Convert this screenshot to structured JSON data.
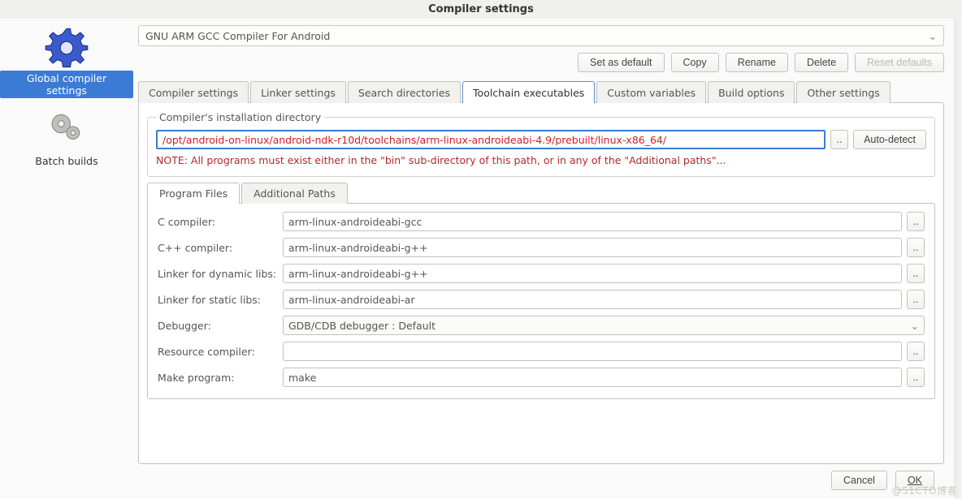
{
  "window_title": "Compiler settings",
  "sidebar": {
    "items": [
      {
        "label": "Global compiler settings",
        "selected": true
      },
      {
        "label": "Batch builds",
        "selected": false
      }
    ]
  },
  "compiler_selector": {
    "value": "GNU ARM GCC Compiler For Android"
  },
  "action_buttons": {
    "set_default": "Set as default",
    "copy": "Copy",
    "rename": "Rename",
    "delete": "Delete",
    "reset_defaults": "Reset defaults"
  },
  "tabs": [
    "Compiler settings",
    "Linker settings",
    "Search directories",
    "Toolchain executables",
    "Custom variables",
    "Build options",
    "Other settings"
  ],
  "active_tab_index": 3,
  "install_dir": {
    "legend": "Compiler's installation directory",
    "path": "/opt/android-on-linux/android-ndk-r10d/toolchains/arm-linux-androideabi-4.9/prebuilt/linux-x86_64/",
    "browse_label": "..",
    "autodetect_label": "Auto-detect",
    "note": "NOTE: All programs must exist either in the \"bin\" sub-directory of this path, or in any of the \"Additional paths\"..."
  },
  "subtabs": [
    "Program Files",
    "Additional Paths"
  ],
  "active_subtab_index": 0,
  "programs": {
    "rows": [
      {
        "label": "C compiler:",
        "value": "arm-linux-androideabi-gcc",
        "browse": true
      },
      {
        "label": "C++ compiler:",
        "value": "arm-linux-androideabi-g++",
        "browse": true
      },
      {
        "label": "Linker for dynamic libs:",
        "value": "arm-linux-androideabi-g++",
        "browse": true
      },
      {
        "label": "Linker for static libs:",
        "value": "arm-linux-androideabi-ar",
        "browse": true
      },
      {
        "label": "Debugger:",
        "value": "GDB/CDB debugger : Default",
        "combo": true
      },
      {
        "label": "Resource compiler:",
        "value": "",
        "browse": true
      },
      {
        "label": "Make program:",
        "value": "make",
        "browse": true
      }
    ],
    "browse_label": ".."
  },
  "footer": {
    "cancel": "Cancel",
    "ok": "OK"
  },
  "watermark": "@51CTO博客"
}
